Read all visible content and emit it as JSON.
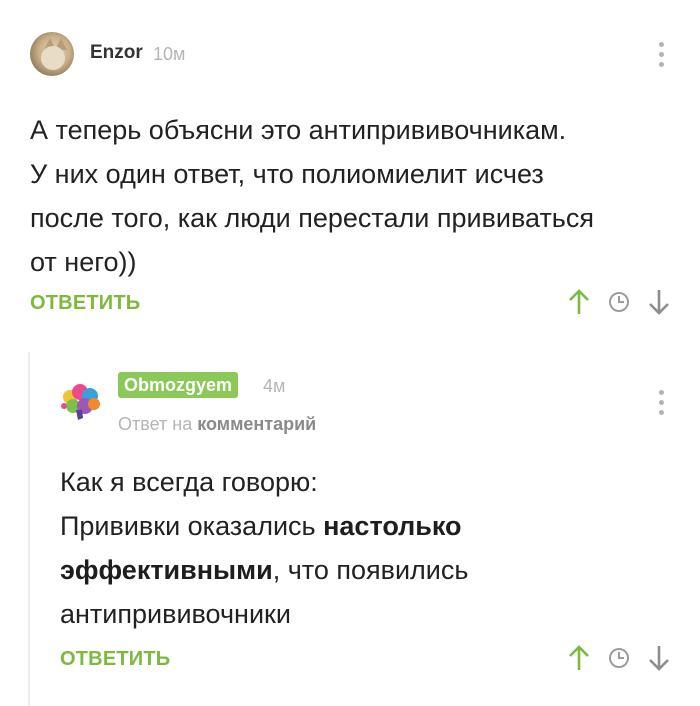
{
  "comment1": {
    "username": "Enzor",
    "time": "10м",
    "lines": [
      "А теперь объясни это антипрививочникам.",
      "У них один ответ, что полиомиелит исчез",
      "после того, как люди перестали прививаться",
      "от него))"
    ],
    "reply_label": "ОТВЕТИТЬ"
  },
  "comment2": {
    "username": "Obmozgyem",
    "time": "4м",
    "reply_to_prefix": "Ответ на",
    "reply_to_target": "комментарий",
    "line1": "Как я всегда говорю:",
    "line2_plain": "Прививки оказались ",
    "line2_bold": "настолько",
    "line3_bold": "эффективными",
    "line3_plain": ", что появились",
    "line4": "антипрививочники",
    "reply_label": "ОТВЕТИТЬ"
  },
  "icons": {
    "upvote": "arrow-up-icon",
    "history": "clock-icon",
    "downvote": "arrow-down-icon",
    "more": "kebab-menu-icon"
  },
  "colors": {
    "accent_green": "#7cba3d",
    "badge_green": "#8ac858",
    "muted_gray": "#b5b5b5"
  }
}
